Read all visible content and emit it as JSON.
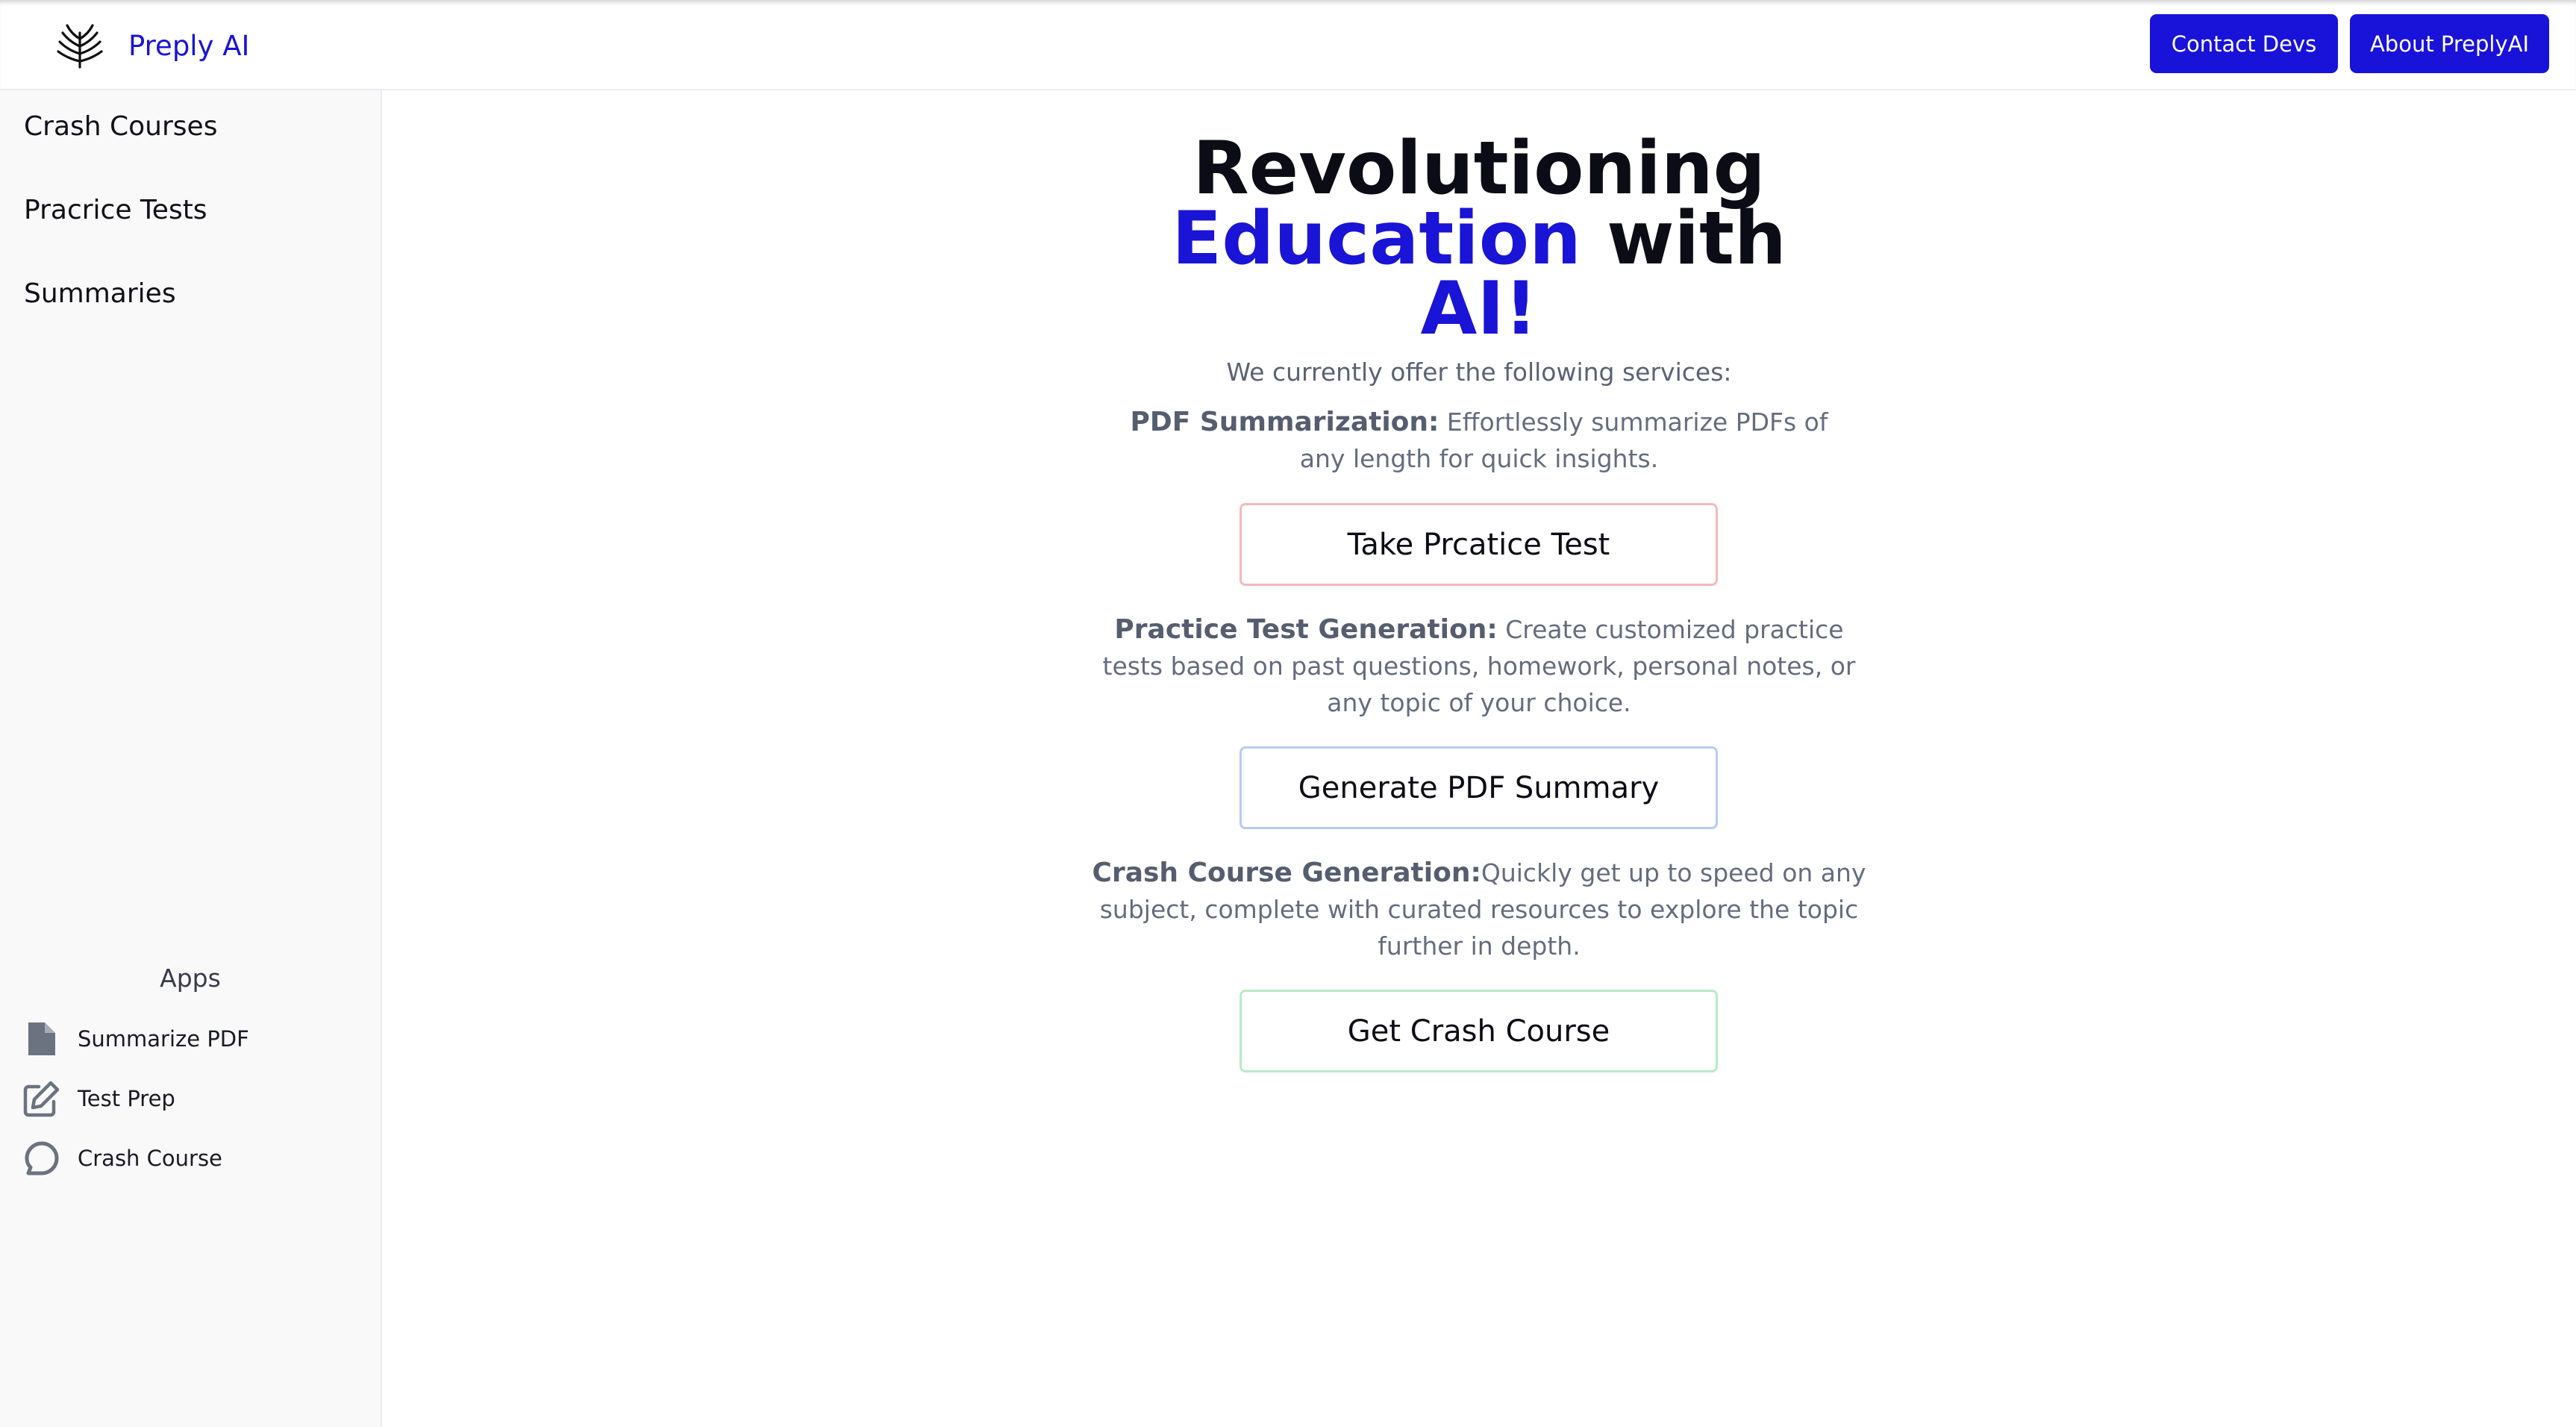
{
  "header": {
    "brand_name": "Preply AI",
    "contact_label": "Contact Devs",
    "about_label": "About PreplyAI"
  },
  "sidebar": {
    "links": [
      {
        "label": "Crash Courses"
      },
      {
        "label": "Pracrice Tests"
      },
      {
        "label": "Summaries"
      }
    ],
    "apps_heading": "Apps",
    "apps": [
      {
        "label": "Summarize PDF",
        "icon": "document-icon"
      },
      {
        "label": "Test Prep",
        "icon": "edit-icon"
      },
      {
        "label": "Crash Course",
        "icon": "chat-bubble-icon"
      }
    ]
  },
  "main": {
    "hero": {
      "line1": "Revolutioning",
      "word_education": "Education",
      "word_with": " with",
      "word_ai": "AI!"
    },
    "intro": "We currently offer the following services:",
    "services": [
      {
        "title": "PDF Summarization:",
        "text": " Effortlessly summarize PDFs of any length for quick insights.",
        "button": "Take Prcatice Test"
      },
      {
        "title": "Practice Test Generation:",
        "text": " Create customized practice tests based on past questions, homework, personal notes, or any topic of your choice.",
        "button": "Generate PDF Summary"
      },
      {
        "title": "Crash Course Generation:",
        "text": "Quickly get up to speed on any subject, complete with curated resources to explore the topic further in depth.",
        "button": "Get Crash Course"
      }
    ]
  },
  "colors": {
    "accent": "#1912d9",
    "brand_text": "#1a14d6",
    "border_red": "#f4b9b9",
    "border_blue": "#b6cdf0",
    "border_green": "#b8ebc4"
  }
}
